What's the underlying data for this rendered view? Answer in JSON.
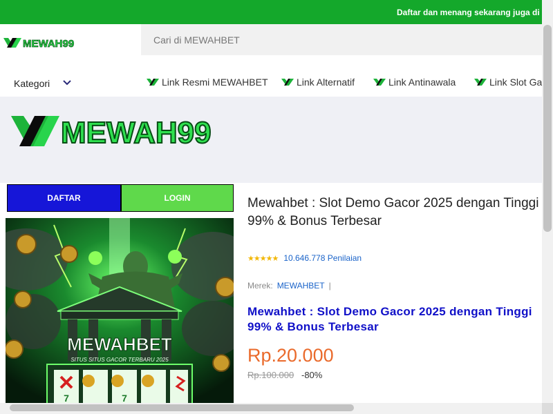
{
  "topbar": {
    "marquee_text": "Daftar dan menang sekarang juga di"
  },
  "header": {
    "logo_text": "MEWAH99",
    "search_placeholder": "Cari di MEWAHBET"
  },
  "nav": {
    "kategori_label": "Kategori",
    "links": [
      {
        "label": "Link Resmi MEWAHBET"
      },
      {
        "label": "Link Alternatif"
      },
      {
        "label": "Link Antinawala"
      },
      {
        "label": "Link Slot Ga"
      }
    ]
  },
  "banner": {
    "logo_text": "MEWAH99"
  },
  "buttons": {
    "daftar_label": "DAFTAR",
    "login_label": "LOGIN"
  },
  "hero": {
    "title_text": "MEWAHBET",
    "subtitle_text": "SITUS SITUS GACOR TERBARU 2025"
  },
  "product": {
    "title": "Mewahbet : Slot Demo Gacor 2025 dengan Tinggi 99% & Bonus Terbesar",
    "stars": "★★★★★",
    "rating_count": "10.646.778 Penilaian",
    "brand_label": "Merek:",
    "brand_value": "MEWAHBET",
    "brand_sep": "|",
    "blue_title": "Mewahbet : Slot Demo Gacor 2025 dengan Tinggi 99% & Bonus Terbesar",
    "price": "Rp.20.000",
    "old_price": "Rp.100.000",
    "discount": "-80%"
  },
  "colors": {
    "topbar_green": "#14a82b",
    "daftar_blue": "#1616d8",
    "login_green": "#5fd94b",
    "price_orange": "#ea6a2b",
    "link_blue": "#1a63c9",
    "title_blue": "#1010c8"
  },
  "icons": {
    "chevron": "chevron-down-icon",
    "link": "mewah-logo-mini-icon"
  }
}
